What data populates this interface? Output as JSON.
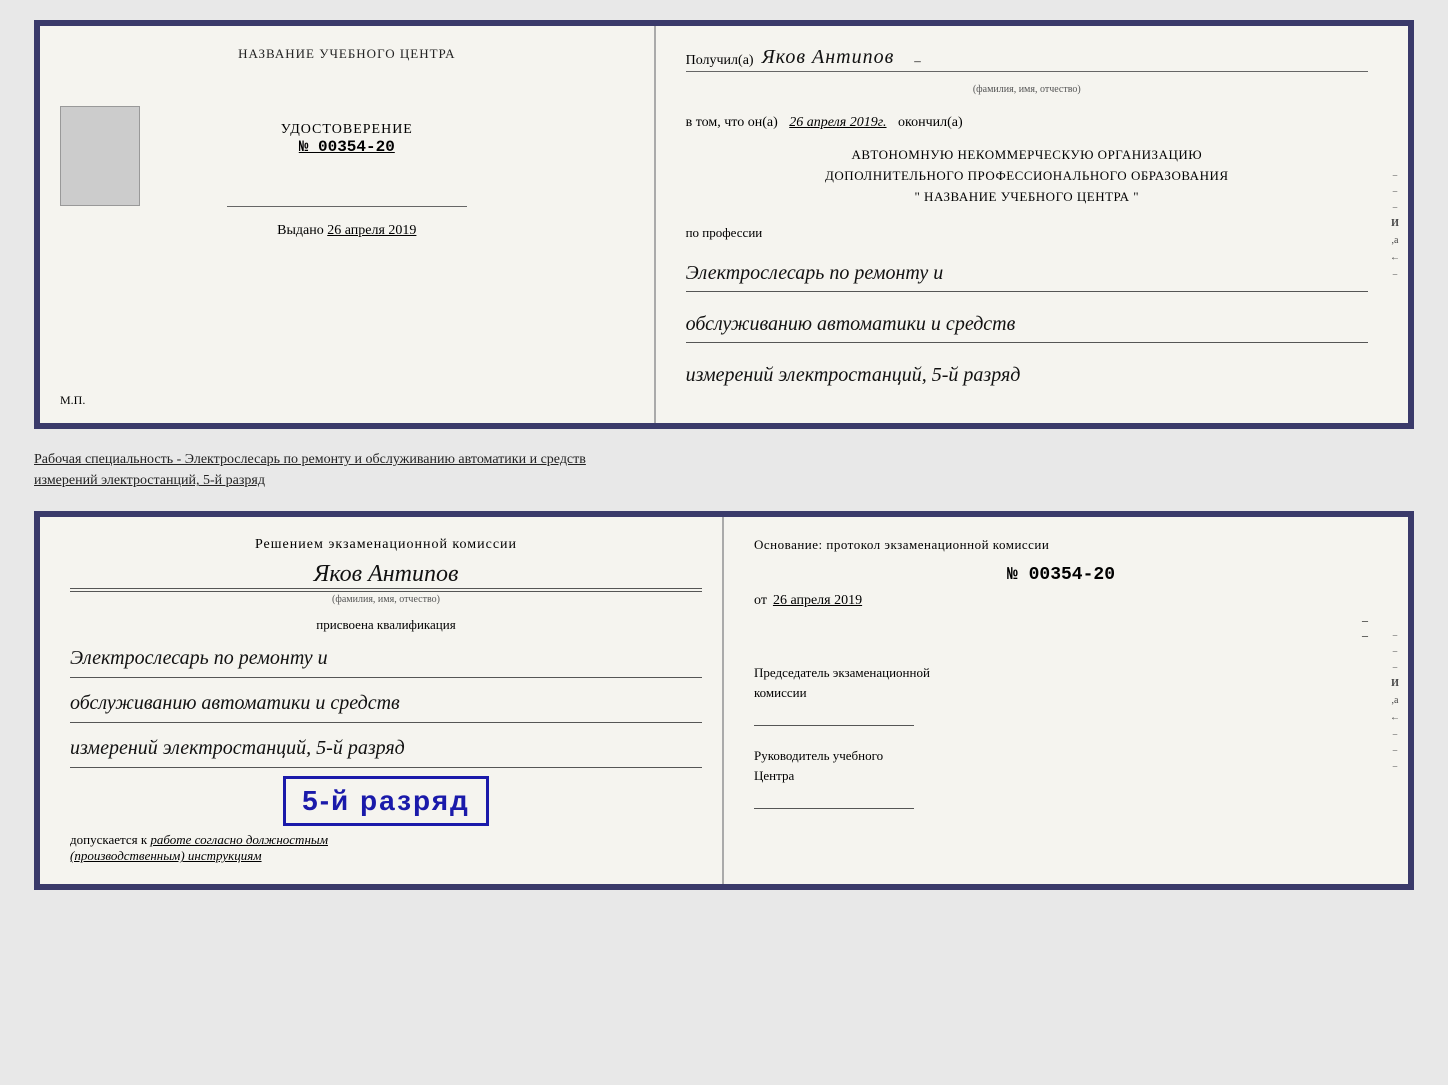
{
  "top_document": {
    "left": {
      "center_title": "НАЗВАНИЕ УЧЕБНОГО ЦЕНТРА",
      "cert_label": "УДОСТОВЕРЕНИЕ",
      "cert_number": "№ 00354-20",
      "issued_label": "Выдано",
      "issued_date": "26 апреля 2019",
      "mp_label": "М.П."
    },
    "right": {
      "received_label": "Получил(а)",
      "name": "Яков Антипов",
      "name_sub": "(фамилия, имя, отчество)",
      "cert_text": "в том, что он(а)",
      "date_value": "26 апреля 2019г.",
      "finished_label": "окончил(а)",
      "org_line1": "АВТОНОМНУЮ НЕКОММЕРЧЕСКУЮ ОРГАНИЗАЦИЮ",
      "org_line2": "ДОПОЛНИТЕЛЬНОГО ПРОФЕССИОНАЛЬНОГО ОБРАЗОВАНИЯ",
      "org_line3": "\"   НАЗВАНИЕ УЧЕБНОГО ЦЕНТРА   \"",
      "profession_label": "по профессии",
      "profession_line1": "Электрослесарь по ремонту и",
      "profession_line2": "обслуживанию автоматики и средств",
      "profession_line3": "измерений электростанций, 5-й разряд",
      "side_letter_i": "И",
      "side_letter_a": ",а",
      "side_letter_arrow": "←"
    }
  },
  "middle_text": "Рабочая специальность - Электрослесарь по ремонту и обслуживанию автоматики и средств\nизмерений электростанций, 5-й разряд",
  "bottom_document": {
    "left": {
      "decision_title": "Решением экзаменационной комиссии",
      "name": "Яков Антипов",
      "name_sub": "(фамилия, имя, отчество)",
      "assigned_label": "присвоена квалификация",
      "qual_line1": "Электрослесарь по ремонту и",
      "qual_line2": "обслуживанию автоматики и средств",
      "qual_line3": "измерений электростанций, 5-й разряд",
      "rank_badge": "5-й разряд",
      "allowed_text": "допускается к",
      "allowed_value": "работе согласно должностным",
      "allowed_value2": "(производственным) инструкциям"
    },
    "right": {
      "basis_label": "Основание: протокол экзаменационной комиссии",
      "protocol_number": "№  00354-20",
      "date_from": "от",
      "date_value": "26 апреля 2019",
      "chairman_title": "Председатель экзаменационной\nкомиссии",
      "head_title": "Руководитель учебного\nЦентра",
      "side_letter_i": "И",
      "side_letter_a": ",а",
      "side_letter_arrow": "←"
    }
  }
}
